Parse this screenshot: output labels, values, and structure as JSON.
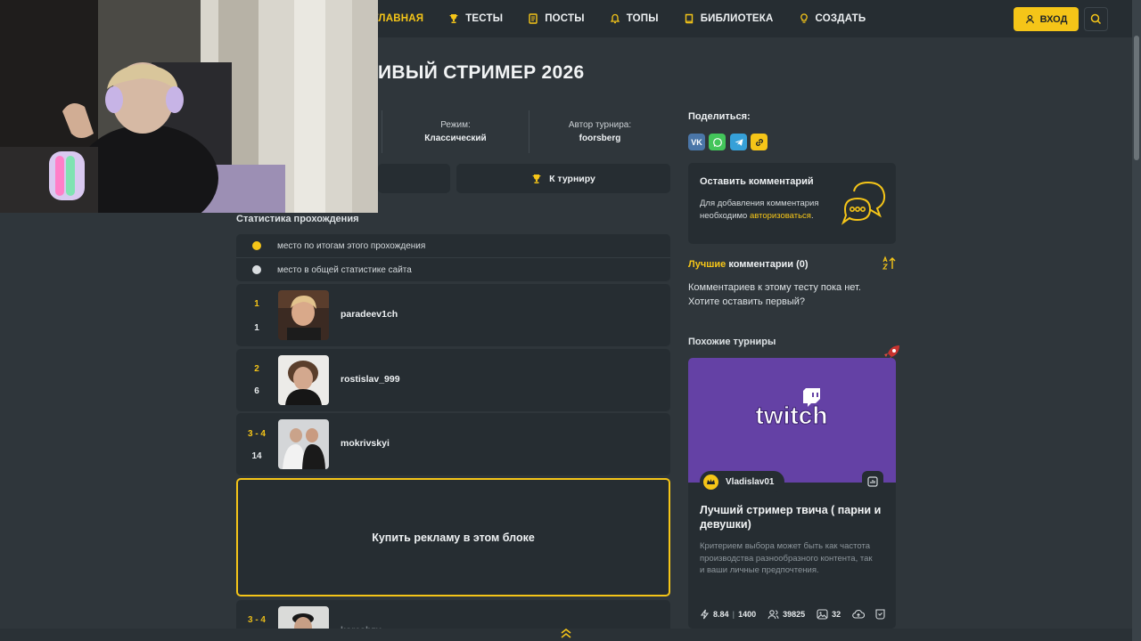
{
  "nav": {
    "items": [
      {
        "label": "ГЛАВНАЯ",
        "icon": "home-icon",
        "active": true
      },
      {
        "label": "ТЕСТЫ",
        "icon": "trophy-icon",
        "active": false
      },
      {
        "label": "ПОСТЫ",
        "icon": "document-icon",
        "active": false
      },
      {
        "label": "ТОПЫ",
        "icon": "bell-icon",
        "active": false
      },
      {
        "label": "БИБЛИОТЕКА",
        "icon": "book-icon",
        "active": false
      },
      {
        "label": "СОЗДАТЬ",
        "icon": "lightbulb-icon",
        "active": false
      }
    ],
    "login_label": "ВХОД"
  },
  "page": {
    "title": "ИВЫЙ СТРИМЕР 2026"
  },
  "info": {
    "mode_label": "Режим:",
    "mode_value": "Классический",
    "author_label": "Автор турнира:",
    "author_value": "foorsberg"
  },
  "actions": {
    "to_tournament": "К турниру"
  },
  "stats": {
    "section_title": "Статистика прохождения",
    "legend_current": "место по итогам этого прохождения",
    "legend_global": "место в общей статистике сайта",
    "rows": [
      {
        "rank": "1",
        "global": "1",
        "name": "paradeev1ch"
      },
      {
        "rank": "2",
        "global": "6",
        "name": "rostislav_999"
      },
      {
        "rank": "3 - 4",
        "global": "14",
        "name": "mokrivskyi"
      },
      {
        "rank": "3 - 4",
        "global": "",
        "name": "koreshzy"
      }
    ],
    "ad_text": "Купить рекламу в этом блоке"
  },
  "sidebar": {
    "share_label": "Поделиться:",
    "share_vk": "VK",
    "comment_title": "Оставить комментарий",
    "comment_text": "Для добавления комментария необходимо ",
    "comment_link": "авторизоваться",
    "comment_text_end": ".",
    "best_hl": "Лучшие",
    "best_rest": " комментарии (0)",
    "no_comments": "Комментариев к этому тесту пока нет. Хотите оставить первый?",
    "similar_title": "Похожие турниры"
  },
  "card": {
    "brand": "twitch",
    "author": "Vladislav01",
    "title": "Лучший стример твича ( парни и девушки)",
    "description": "Критерием выбора может быть как частота производства разнообразного контента, так и ваши личные предпочтения.",
    "rating": "8.84",
    "votes": "1400",
    "players": "39825",
    "images": "32"
  },
  "colors": {
    "accent": "#f5c518",
    "background": "#2f363b",
    "panel": "#262d32",
    "twitch": "#6441a5"
  }
}
